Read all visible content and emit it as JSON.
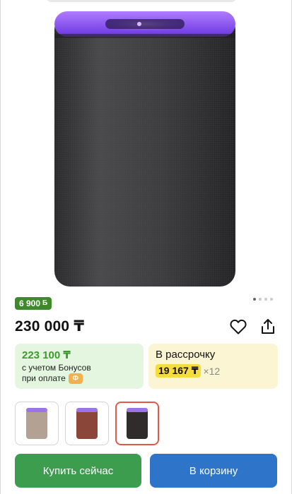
{
  "product": {
    "image_icon": "smart-speaker-image",
    "gallery_total": 4,
    "gallery_active": 1
  },
  "bonus_badge": {
    "amount": "6 900",
    "icon": "bonus-coin-icon"
  },
  "price": {
    "main": "230 000 ₸"
  },
  "actions": {
    "favorite_icon": "heart-icon",
    "share_icon": "share-icon"
  },
  "bonus_card": {
    "price": "223 100 ₸",
    "line1": "с учетом Бонусов",
    "line2": "при оплате",
    "chip": "Ф"
  },
  "installment_card": {
    "title": "В рассрочку",
    "monthly": "19 167 ₸",
    "multiplier": "×12"
  },
  "variants": [
    {
      "color": "#b3a294",
      "selected": false
    },
    {
      "color": "#8a4638",
      "selected": false
    },
    {
      "color": "#2f2c2b",
      "selected": true
    }
  ],
  "buttons": {
    "buy_now": "Купить сейчас",
    "add_to_cart": "В корзину"
  },
  "colors": {
    "buy_button": "#3d9d4e",
    "cart_button": "#2e74c8",
    "badge_green": "#3e8a2b",
    "bonus_price": "#3b9b2a",
    "installment_highlight": "#f6dc3f"
  }
}
